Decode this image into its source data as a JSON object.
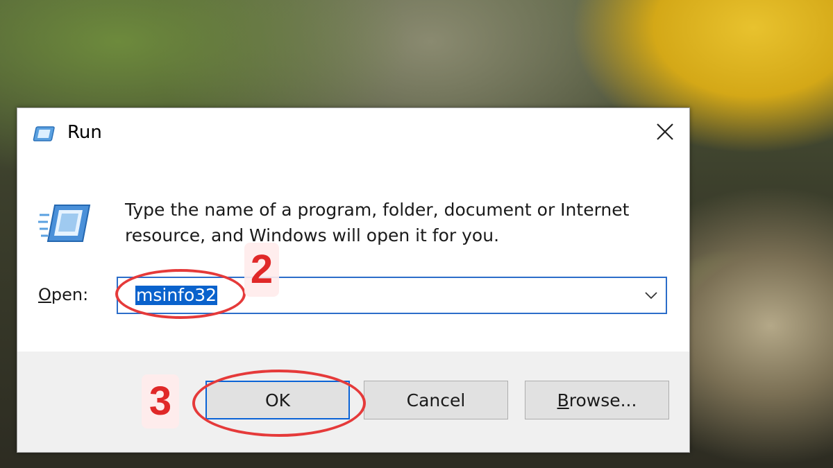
{
  "window": {
    "title": "Run",
    "close_icon": "close-icon",
    "app_icon": "run-icon"
  },
  "main": {
    "description": "Type the name of a program, folder, document or Internet resource, and Windows will open it for you.",
    "open_label_mnemonic": "O",
    "open_label_rest": "pen:",
    "open_value": "msinfo32",
    "dropdown_icon": "chevron-down-icon"
  },
  "buttons": {
    "ok": "OK",
    "cancel": "Cancel",
    "browse_mnemonic": "B",
    "browse_rest": "rowse..."
  },
  "annotations": {
    "step_input": "2",
    "step_ok": "3",
    "color": "#e53a3a"
  }
}
